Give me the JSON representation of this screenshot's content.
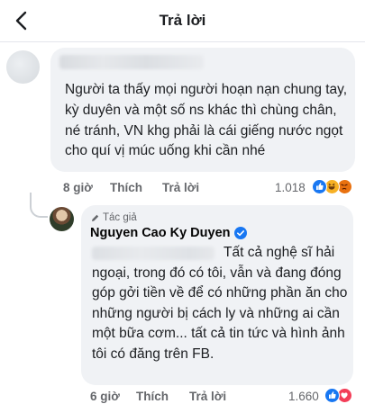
{
  "header": {
    "title": "Trả lời"
  },
  "comment1": {
    "text": "Người ta thấy mọi người hoạn nạn chung tay,  kỳ duyên và một số ns khác thì chùng chân,  né tránh,  VN khg phải là cái giếng nước ngọt cho quí vị múc uống khi cần nhé",
    "time": "8 giờ",
    "like_label": "Thích",
    "reply_label": "Trả lời",
    "reaction_count": "1.018",
    "reaction_icons": [
      "like-icon",
      "haha-icon",
      "angry-icon"
    ]
  },
  "reply": {
    "author_badge": "Tác giả",
    "author_name": "Nguyen Cao Ky Duyen",
    "text": "Tất cả nghệ sĩ hải ngoại, trong đó có tôi, vẫn và đang đóng góp gởi tiền về để có những phần ăn cho những người bị cách ly và những ai cần một bữa cơm... tất cả tin tức và hình ảnh tôi có đăng trên FB.",
    "time": "6 giờ",
    "like_label": "Thích",
    "reply_label": "Trả lời",
    "reaction_count": "1.660",
    "reaction_icons": [
      "like-icon",
      "love-icon"
    ]
  },
  "colors": {
    "like_blue": "#1877f2",
    "love_red": "#f33e58",
    "haha_yellow": "#f7b125",
    "angry_orange": "#e9710f",
    "bubble": "#f0f2f5"
  }
}
